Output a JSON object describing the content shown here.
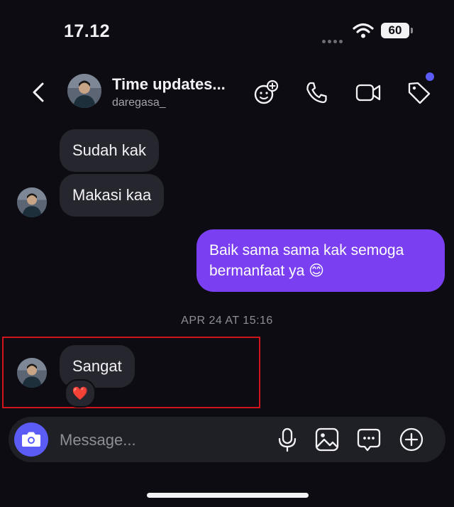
{
  "status_bar": {
    "time": "17.12",
    "battery": "60"
  },
  "header": {
    "title": "Time updates...",
    "subtitle": "daregasa_"
  },
  "messages": {
    "incoming_1": "Sudah kak",
    "incoming_2": "Makasi kaa",
    "outgoing_1": "Baik sama sama kak semoga bermanfaat ya 😊",
    "timestamp": "APR 24 AT 15:16",
    "incoming_3": "Sangat",
    "reaction": "❤️"
  },
  "composer": {
    "placeholder": "Message..."
  },
  "colors": {
    "background": "#0c0c12",
    "incoming_bubble": "#26262e",
    "outgoing_bubble": "#7a3ff0",
    "accent": "#5b5cf5",
    "highlight": "#d0141e"
  },
  "icons": [
    "back-icon",
    "add-sticker-icon",
    "phone-icon",
    "video-camera-icon",
    "tag-icon",
    "camera-icon",
    "microphone-icon",
    "gallery-icon",
    "sticker-chat-icon",
    "plus-circle-icon"
  ]
}
